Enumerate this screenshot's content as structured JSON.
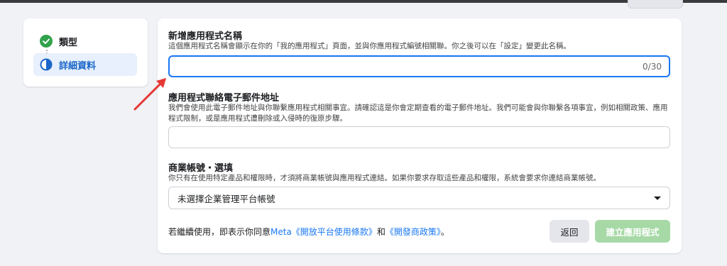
{
  "colors": {
    "accent": "#1877f2",
    "success": "#31a24c",
    "arrow": "#e53935",
    "create_button_disabled": "#a7d9a7"
  },
  "steps": [
    {
      "label": "類型",
      "icon": "check-circle-icon",
      "state": "complete"
    },
    {
      "label": "詳細資料",
      "icon": "half-circle-icon",
      "state": "current"
    }
  ],
  "form": {
    "app_name": {
      "title": "新增應用程式名稱",
      "description": "這個應用程式名稱會顯示在你的「我的應用程式」頁面，並與你應用程式編號相關聯。你之後可以在「設定」變更此名稱。",
      "value": "",
      "counter": "0/30"
    },
    "email": {
      "title": "應用程式聯絡電子郵件地址",
      "description": "我們會使用此電子郵件地址與你聯繫應用程式相關事宜。請確認這是你會定期查看的電子郵件地址。我們可能會與你聯繫各項事宜，例如相關政策、應用程式限制，或是應用程式遭刪除或入侵時的復原步驟。",
      "value": ""
    },
    "business": {
      "title": "商業帳號・選填",
      "description": "你只有在使用特定產品和權限時，才須將商業帳號與應用程式連結。如果你要求存取這些產品和權限，系統會要求你連結商業帳號。",
      "selected": "未選擇企業管理平台帳號"
    }
  },
  "footer": {
    "prefix": "若繼續使用，即表示你同意",
    "link1": "Meta《開放平台使用條款》",
    "middle": "和",
    "link2": "《開發商政策》",
    "suffix": "。",
    "back_label": "返回",
    "create_label": "建立應用程式"
  }
}
